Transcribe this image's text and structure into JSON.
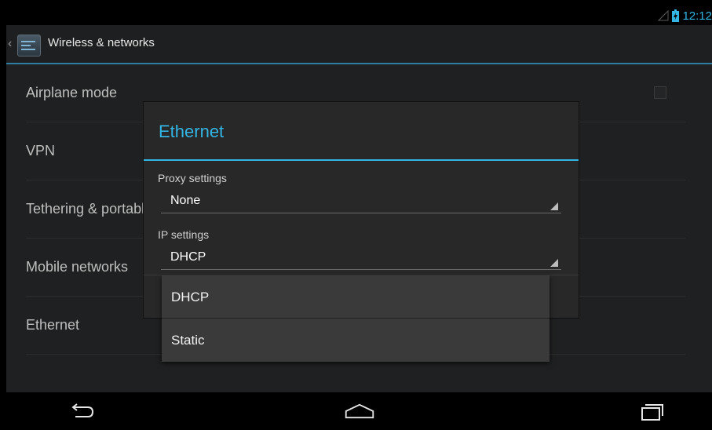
{
  "status_bar": {
    "time": "12:12",
    "icons": [
      "signal-icon",
      "battery-charging-icon"
    ]
  },
  "action_bar": {
    "title": "Wireless & networks",
    "app_icon": "wireless-settings-icon"
  },
  "settings_list": [
    {
      "label": "Airplane mode",
      "has_checkbox": true
    },
    {
      "label": "VPN"
    },
    {
      "label": "Tethering & portable hotspot"
    },
    {
      "label": "Mobile networks"
    },
    {
      "label": "Ethernet"
    }
  ],
  "dialog": {
    "title": "Ethernet",
    "proxy_label": "Proxy settings",
    "proxy_value": "None",
    "ip_label": "IP settings",
    "ip_value": "DHCP"
  },
  "dropdown": {
    "options": [
      "DHCP",
      "Static"
    ]
  },
  "nav_bar": {
    "buttons": [
      "back-icon",
      "home-icon",
      "recent-apps-icon"
    ]
  },
  "colors": {
    "accent": "#33b5e5",
    "background": "#1f2021",
    "dialog": "#282828"
  }
}
